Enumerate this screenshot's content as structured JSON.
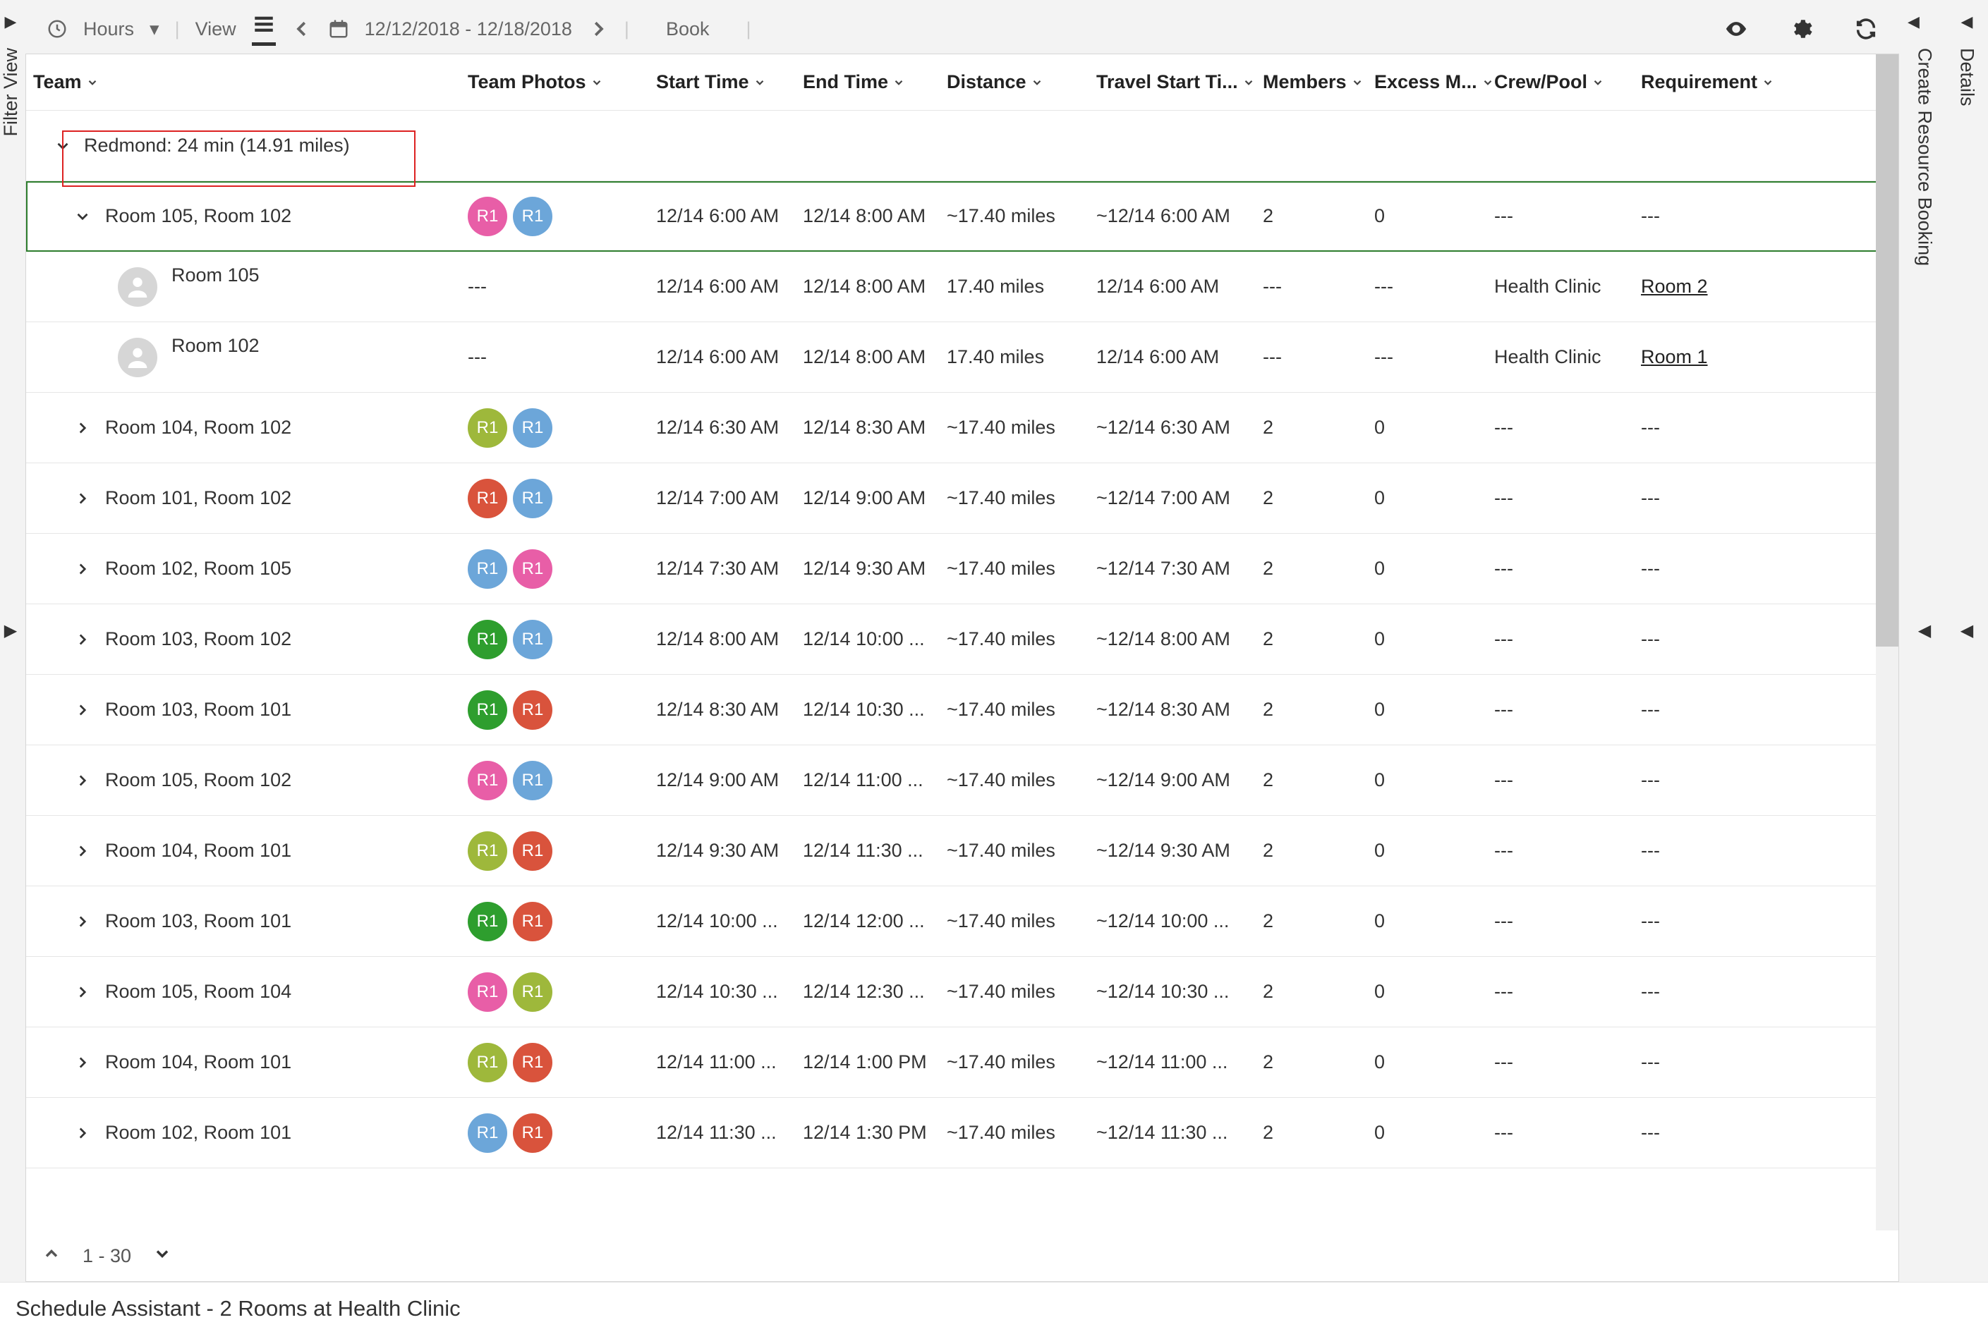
{
  "toolbar": {
    "hours_label": "Hours",
    "view_label": "View",
    "date_range": "12/12/2018 - 12/18/2018",
    "book_label": "Book"
  },
  "rail_left": {
    "label": "Filter View"
  },
  "rail_right_1": {
    "label": "Details"
  },
  "rail_right_2": {
    "label": "Create Resource Booking"
  },
  "columns": {
    "team": "Team",
    "photos": "Team Photos",
    "start": "Start Time",
    "end": "End Time",
    "distance": "Distance",
    "travel_start": "Travel Start Ti...",
    "members": "Members",
    "excess": "Excess M...",
    "crew": "Crew/Pool",
    "requirement": "Requirement"
  },
  "group_header": "Redmond: 24 min (14.91 miles)",
  "rows": [
    {
      "type": "team",
      "expanded": true,
      "selected": true,
      "indent": 1,
      "name": "Room 105, Room 102",
      "badges": [
        "pink",
        "blue"
      ],
      "start": "12/14 6:00 AM",
      "end": "12/14 8:00 AM",
      "dist": "~17.40 miles",
      "trav": "~12/14 6:00 AM",
      "mem": "2",
      "exc": "0",
      "crew": "---",
      "req": "---"
    },
    {
      "type": "member",
      "indent": 2,
      "name": "Room 105",
      "photos": "---",
      "start": "12/14 6:00 AM",
      "end": "12/14 8:00 AM",
      "dist": "17.40 miles",
      "trav": "12/14 6:00 AM",
      "mem": "---",
      "exc": "---",
      "crew": "Health Clinic",
      "req": "Room 2",
      "req_link": true
    },
    {
      "type": "member",
      "indent": 2,
      "name": "Room 102",
      "photos": "---",
      "start": "12/14 6:00 AM",
      "end": "12/14 8:00 AM",
      "dist": "17.40 miles",
      "trav": "12/14 6:00 AM",
      "mem": "---",
      "exc": "---",
      "crew": "Health Clinic",
      "req": "Room 1",
      "req_link": true
    },
    {
      "type": "team",
      "expanded": false,
      "indent": 1,
      "name": "Room 104, Room 102",
      "badges": [
        "olive",
        "blue"
      ],
      "start": "12/14 6:30 AM",
      "end": "12/14 8:30 AM",
      "dist": "~17.40 miles",
      "trav": "~12/14 6:30 AM",
      "mem": "2",
      "exc": "0",
      "crew": "---",
      "req": "---"
    },
    {
      "type": "team",
      "expanded": false,
      "indent": 1,
      "name": "Room 101, Room 102",
      "badges": [
        "red",
        "blue"
      ],
      "start": "12/14 7:00 AM",
      "end": "12/14 9:00 AM",
      "dist": "~17.40 miles",
      "trav": "~12/14 7:00 AM",
      "mem": "2",
      "exc": "0",
      "crew": "---",
      "req": "---"
    },
    {
      "type": "team",
      "expanded": false,
      "indent": 1,
      "name": "Room 102, Room 105",
      "badges": [
        "blue",
        "pink"
      ],
      "start": "12/14 7:30 AM",
      "end": "12/14 9:30 AM",
      "dist": "~17.40 miles",
      "trav": "~12/14 7:30 AM",
      "mem": "2",
      "exc": "0",
      "crew": "---",
      "req": "---"
    },
    {
      "type": "team",
      "expanded": false,
      "indent": 1,
      "name": "Room 103, Room 102",
      "badges": [
        "green",
        "blue"
      ],
      "start": "12/14 8:00 AM",
      "end": "12/14 10:00 ...",
      "dist": "~17.40 miles",
      "trav": "~12/14 8:00 AM",
      "mem": "2",
      "exc": "0",
      "crew": "---",
      "req": "---"
    },
    {
      "type": "team",
      "expanded": false,
      "indent": 1,
      "name": "Room 103, Room 101",
      "badges": [
        "green",
        "red"
      ],
      "start": "12/14 8:30 AM",
      "end": "12/14 10:30 ...",
      "dist": "~17.40 miles",
      "trav": "~12/14 8:30 AM",
      "mem": "2",
      "exc": "0",
      "crew": "---",
      "req": "---"
    },
    {
      "type": "team",
      "expanded": false,
      "indent": 1,
      "name": "Room 105, Room 102",
      "badges": [
        "pink",
        "blue"
      ],
      "start": "12/14 9:00 AM",
      "end": "12/14 11:00 ...",
      "dist": "~17.40 miles",
      "trav": "~12/14 9:00 AM",
      "mem": "2",
      "exc": "0",
      "crew": "---",
      "req": "---"
    },
    {
      "type": "team",
      "expanded": false,
      "indent": 1,
      "name": "Room 104, Room 101",
      "badges": [
        "olive",
        "red"
      ],
      "start": "12/14 9:30 AM",
      "end": "12/14 11:30 ...",
      "dist": "~17.40 miles",
      "trav": "~12/14 9:30 AM",
      "mem": "2",
      "exc": "0",
      "crew": "---",
      "req": "---"
    },
    {
      "type": "team",
      "expanded": false,
      "indent": 1,
      "name": "Room 103, Room 101",
      "badges": [
        "green",
        "red"
      ],
      "start": "12/14 10:00 ...",
      "end": "12/14 12:00 ...",
      "dist": "~17.40 miles",
      "trav": "~12/14 10:00 ...",
      "mem": "2",
      "exc": "0",
      "crew": "---",
      "req": "---"
    },
    {
      "type": "team",
      "expanded": false,
      "indent": 1,
      "name": "Room 105, Room 104",
      "badges": [
        "pink",
        "olive"
      ],
      "start": "12/14 10:30 ...",
      "end": "12/14 12:30 ...",
      "dist": "~17.40 miles",
      "trav": "~12/14 10:30 ...",
      "mem": "2",
      "exc": "0",
      "crew": "---",
      "req": "---"
    },
    {
      "type": "team",
      "expanded": false,
      "indent": 1,
      "name": "Room 104, Room 101",
      "badges": [
        "olive",
        "red"
      ],
      "start": "12/14 11:00 ...",
      "end": "12/14 1:00 PM",
      "dist": "~17.40 miles",
      "trav": "~12/14 11:00 ...",
      "mem": "2",
      "exc": "0",
      "crew": "---",
      "req": "---"
    },
    {
      "type": "team",
      "expanded": false,
      "indent": 1,
      "name": "Room 102, Room 101",
      "badges": [
        "blue",
        "red"
      ],
      "start": "12/14 11:30 ...",
      "end": "12/14 1:30 PM",
      "dist": "~17.40 miles",
      "trav": "~12/14 11:30 ...",
      "mem": "2",
      "exc": "0",
      "crew": "---",
      "req": "---"
    }
  ],
  "pager": {
    "range": "1 - 30"
  },
  "status": "Schedule Assistant - 2 Rooms at Health Clinic"
}
